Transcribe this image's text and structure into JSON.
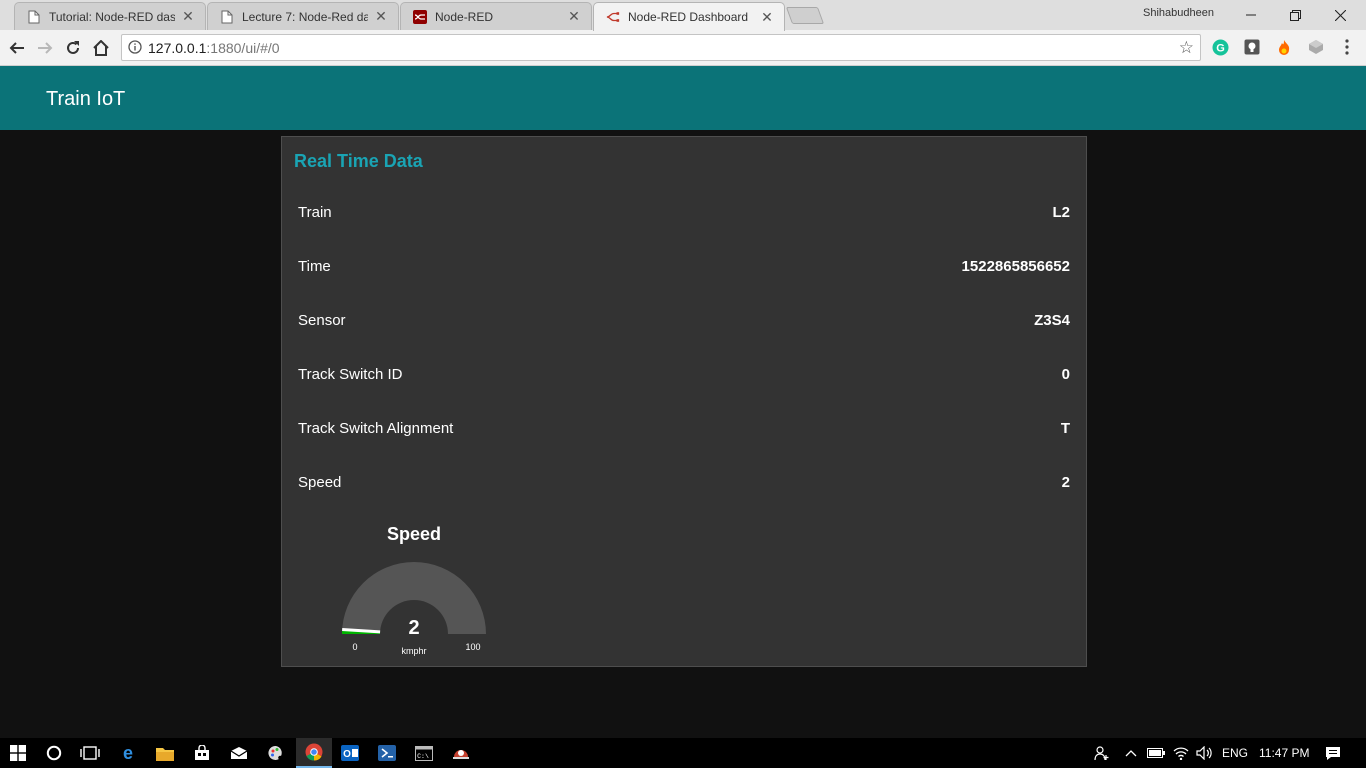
{
  "browser": {
    "tabs": [
      {
        "title": "Tutorial: Node-RED dashb",
        "icon": "page-icon"
      },
      {
        "title": "Lecture 7: Node-Red das",
        "icon": "page-icon"
      },
      {
        "title": "Node-RED",
        "icon": "node-red-icon"
      },
      {
        "title": "Node-RED Dashboard",
        "icon": "node-red-flow-icon"
      }
    ],
    "profile_name": "Shihabudheen",
    "address": {
      "host": "127.0.0.1",
      "path": ":1880/ui/#/0"
    }
  },
  "dashboard": {
    "title": "Train IoT",
    "group_title": "Real Time Data",
    "rows": [
      {
        "label": "Train",
        "value": "L2"
      },
      {
        "label": "Time",
        "value": "1522865856652"
      },
      {
        "label": "Sensor",
        "value": "Z3S4"
      },
      {
        "label": "Track Switch ID",
        "value": "0"
      },
      {
        "label": "Track Switch Alignment",
        "value": "T"
      },
      {
        "label": "Speed",
        "value": "2"
      }
    ],
    "gauge": {
      "title": "Speed",
      "value": 2,
      "value_text": "2",
      "min": 0,
      "max": 100,
      "min_label": "0",
      "max_label": "100",
      "units": "kmphr",
      "fill_color": "#00b500",
      "track_color": "#555555"
    }
  },
  "taskbar": {
    "language": "ENG",
    "time": "11:47 PM"
  },
  "colors": {
    "header": "#0b7378",
    "accent": "#1aa4b4",
    "card": "#333333",
    "background": "#111111"
  }
}
